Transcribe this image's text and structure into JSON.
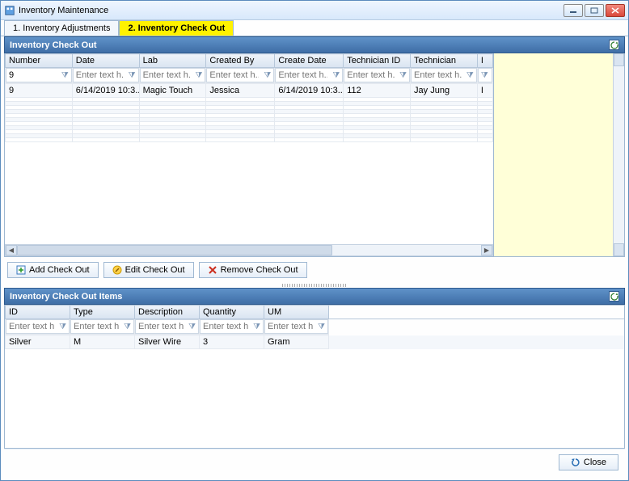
{
  "window": {
    "title": "Inventory Maintenance"
  },
  "tabs": [
    {
      "label": "1. Inventory Adjustments"
    },
    {
      "label": "2. Inventory Check Out"
    }
  ],
  "group1": {
    "title": "Inventory Check Out"
  },
  "checkout_grid": {
    "headers": [
      "Number",
      "Date",
      "Lab",
      "Created By",
      "Create Date",
      "Technician ID",
      "Technician",
      "I"
    ],
    "filter_placeholder": "Enter text h...",
    "first_filter_value": "9",
    "row": {
      "number": "9",
      "date": "6/14/2019 10:3...",
      "lab": "Magic Touch",
      "created_by": "Jessica",
      "create_date": "6/14/2019 10:3...",
      "tech_id": "112",
      "technician": "Jay Jung",
      "extra": "I"
    }
  },
  "buttons": {
    "add": "Add Check Out",
    "edit": "Edit Check Out",
    "remove": "Remove Check Out"
  },
  "group2": {
    "title": "Inventory Check Out Items"
  },
  "items_grid": {
    "headers": [
      "ID",
      "Type",
      "Description",
      "Quantity",
      "UM"
    ],
    "filter_placeholder": "Enter text h...",
    "row": {
      "id": "Silver",
      "type": "M",
      "description": "Silver Wire",
      "quantity": "3",
      "um": "Gram"
    }
  },
  "footer": {
    "close": "Close"
  }
}
